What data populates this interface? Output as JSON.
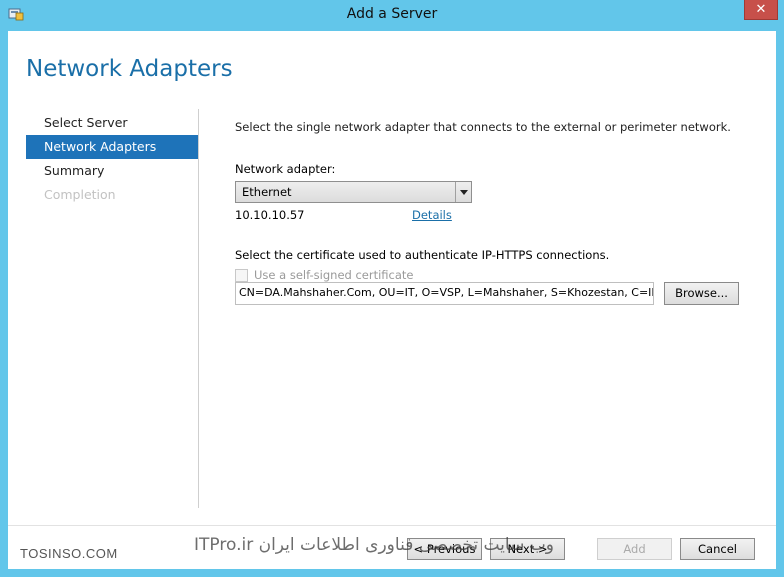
{
  "window": {
    "title": "Add a Server",
    "close_label": "✕"
  },
  "page": {
    "title": "Network Adapters"
  },
  "nav": {
    "items": [
      {
        "label": "Select Server"
      },
      {
        "label": "Network Adapters"
      },
      {
        "label": "Summary"
      },
      {
        "label": "Completion"
      }
    ]
  },
  "content": {
    "instruction": "Select the single network adapter that connects to the external or perimeter network.",
    "adapter_label": "Network adapter:",
    "adapter_value": "Ethernet",
    "ip_address": "10.10.10.57",
    "details_link": "Details",
    "cert_label": "Select the certificate used to authenticate IP-HTTPS connections.",
    "self_signed_label": "Use a self-signed certificate",
    "cert_value": "CN=DA.Mahshaher.Com, OU=IT, O=VSP, L=Mahshaher, S=Khozestan, C=IR",
    "browse_label": "Browse..."
  },
  "footer": {
    "previous_label": "< Previous",
    "next_label": "Next >",
    "add_label": "Add",
    "cancel_label": "Cancel"
  },
  "watermark": {
    "left": "TOSINSO.COM",
    "right": "وب سایت تخصصی فناوری اطلاعات ایران ITPro.ir"
  }
}
